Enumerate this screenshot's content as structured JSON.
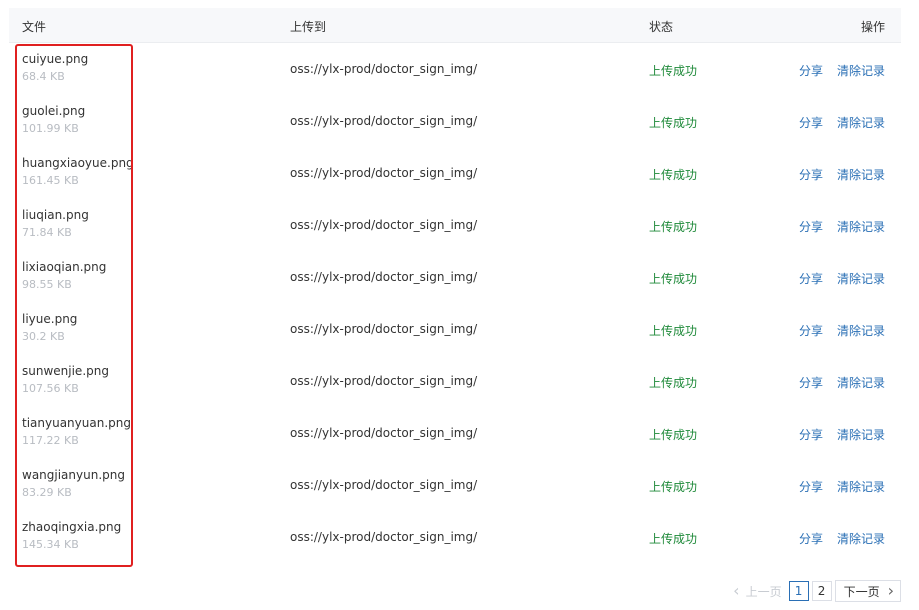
{
  "table": {
    "headers": {
      "file": "文件",
      "destination": "上传到",
      "status": "状态",
      "actions": "操作"
    },
    "rows": [
      {
        "name": "cuiyue.png",
        "size": "68.4 KB",
        "destination": "oss://ylx-prod/doctor_sign_img/",
        "status": "上传成功",
        "share": "分享",
        "clear": "清除记录"
      },
      {
        "name": "guolei.png",
        "size": "101.99 KB",
        "destination": "oss://ylx-prod/doctor_sign_img/",
        "status": "上传成功",
        "share": "分享",
        "clear": "清除记录"
      },
      {
        "name": "huangxiaoyue.png",
        "size": "161.45 KB",
        "destination": "oss://ylx-prod/doctor_sign_img/",
        "status": "上传成功",
        "share": "分享",
        "clear": "清除记录"
      },
      {
        "name": "liuqian.png",
        "size": "71.84 KB",
        "destination": "oss://ylx-prod/doctor_sign_img/",
        "status": "上传成功",
        "share": "分享",
        "clear": "清除记录"
      },
      {
        "name": "lixiaoqian.png",
        "size": "98.55 KB",
        "destination": "oss://ylx-prod/doctor_sign_img/",
        "status": "上传成功",
        "share": "分享",
        "clear": "清除记录"
      },
      {
        "name": "liyue.png",
        "size": "30.2 KB",
        "destination": "oss://ylx-prod/doctor_sign_img/",
        "status": "上传成功",
        "share": "分享",
        "clear": "清除记录"
      },
      {
        "name": "sunwenjie.png",
        "size": "107.56 KB",
        "destination": "oss://ylx-prod/doctor_sign_img/",
        "status": "上传成功",
        "share": "分享",
        "clear": "清除记录"
      },
      {
        "name": "tianyuanyuan.png",
        "size": "117.22 KB",
        "destination": "oss://ylx-prod/doctor_sign_img/",
        "status": "上传成功",
        "share": "分享",
        "clear": "清除记录"
      },
      {
        "name": "wangjianyun.png",
        "size": "83.29 KB",
        "destination": "oss://ylx-prod/doctor_sign_img/",
        "status": "上传成功",
        "share": "分享",
        "clear": "清除记录"
      },
      {
        "name": "zhaoqingxia.png",
        "size": "145.34 KB",
        "destination": "oss://ylx-prod/doctor_sign_img/",
        "status": "上传成功",
        "share": "分享",
        "clear": "清除记录"
      }
    ]
  },
  "pagination": {
    "prev_label": "上一页",
    "pages": [
      "1",
      "2"
    ],
    "current_page": "1",
    "next_label": "下一页"
  },
  "colors": {
    "status_success": "#1f8a3a",
    "link": "#2a6fb5",
    "highlight_border": "#e02020"
  },
  "icons": {
    "prev": "chevron-left-icon",
    "next": "chevron-right-icon"
  }
}
